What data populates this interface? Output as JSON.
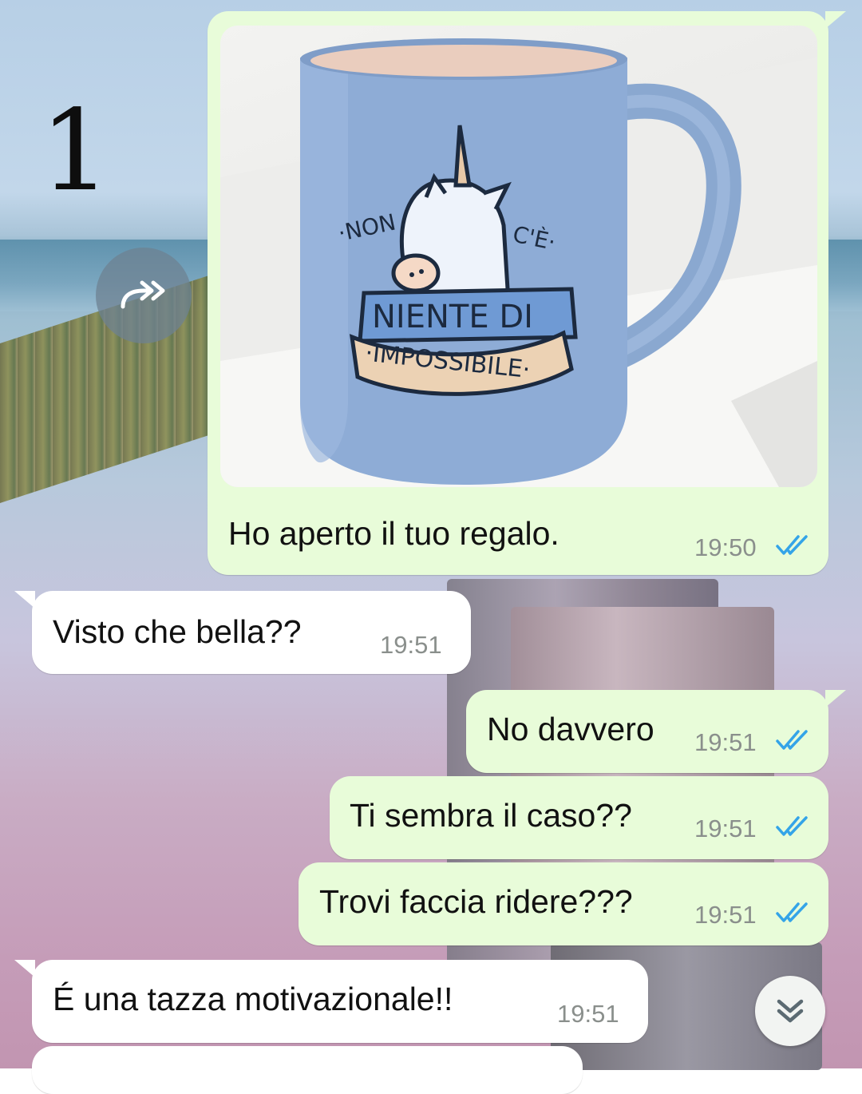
{
  "overlay_number": "1",
  "icons": {
    "forward": "forward-icon",
    "read_receipt": "double-check-icon",
    "scroll_down": "chevron-double-down-icon"
  },
  "colors": {
    "outgoing_bubble": "#e8fcd9",
    "incoming_bubble": "#ffffff",
    "read_tick": "#34a4e8",
    "time": "#8a8f8c"
  },
  "photo": {
    "mug_print": {
      "top_left": "·NON",
      "top_right": "C'È·",
      "banner": "NIENTE DI",
      "ribbon": "·IMPOSSIBILE·"
    }
  },
  "messages": [
    {
      "direction": "out",
      "text": "Ho aperto il tuo regalo.",
      "time": "19:50",
      "read": true
    },
    {
      "direction": "in",
      "text": "Visto che bella??",
      "time": "19:51"
    },
    {
      "direction": "out",
      "text": "No davvero",
      "time": "19:51",
      "read": true
    },
    {
      "direction": "out",
      "text": "Ti sembra il caso??",
      "time": "19:51",
      "read": true
    },
    {
      "direction": "out",
      "text": "Trovi faccia ridere???",
      "time": "19:51",
      "read": true
    },
    {
      "direction": "in",
      "text": "É una tazza motivazionale!!",
      "time": "19:51"
    }
  ]
}
